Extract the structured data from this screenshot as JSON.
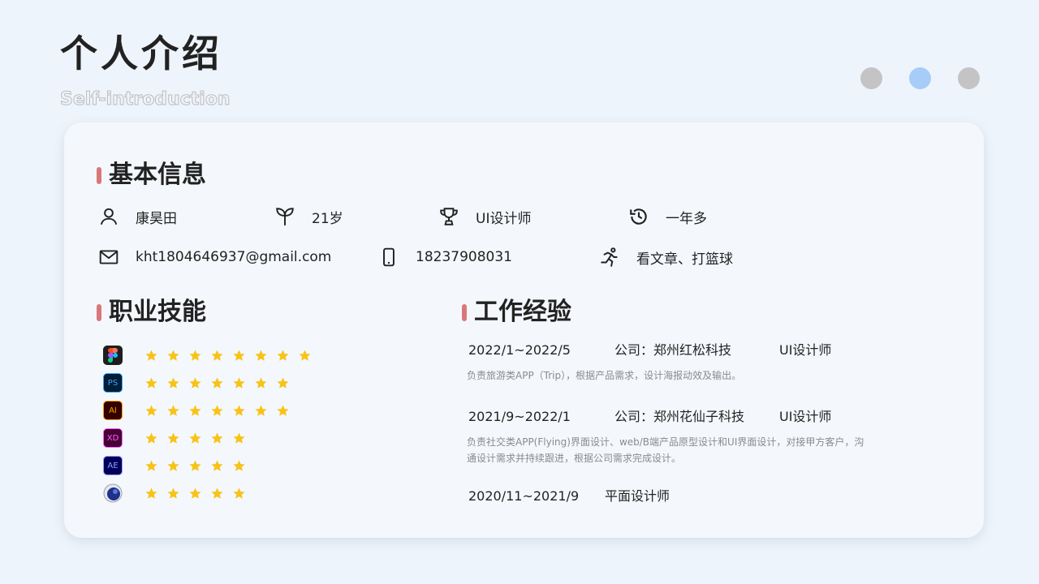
{
  "header": {
    "title": "个人介绍",
    "subtitle": "Self-introduction",
    "page_dots": [
      {
        "active": false
      },
      {
        "active": true
      },
      {
        "active": false
      }
    ]
  },
  "basic_info": {
    "title": "基本信息",
    "name": "康昊田",
    "age": "21岁",
    "role": "UI设计师",
    "experience": "一年多",
    "email": "kht1804646937@gmail.com",
    "phone": "18237908031",
    "hobbies": "看文章、打篮球",
    "icons": [
      "user-icon",
      "sprout-icon",
      "trophy-icon",
      "history-icon",
      "mail-icon",
      "phone-icon",
      "running-icon"
    ]
  },
  "skills": {
    "title": "职业技能",
    "items": [
      {
        "icon": "figma-icon",
        "app_label": "",
        "rating": 8,
        "color": "#1e1e1e"
      },
      {
        "icon": "photoshop-icon",
        "app_label": "PS",
        "rating": 7,
        "color": "#001e36"
      },
      {
        "icon": "illustrator-icon",
        "app_label": "AI",
        "rating": 7,
        "color": "#330000"
      },
      {
        "icon": "xd-icon",
        "app_label": "XD",
        "rating": 5,
        "color": "#470137"
      },
      {
        "icon": "after-effects-icon",
        "app_label": "AE",
        "rating": 5,
        "color": "#00005b"
      },
      {
        "icon": "cinema4d-icon",
        "app_label": "",
        "rating": 5,
        "color": "#1a2a7a"
      }
    ],
    "star_color": "#f8c318"
  },
  "work": {
    "title": "工作经验",
    "jobs": [
      {
        "period": "2022/1~2022/5",
        "company": "公司：郑州红松科技",
        "role": "UI设计师",
        "desc": "负责旅游类APP（Trip），根据产品需求，设计海报动效及输出。"
      },
      {
        "period": "2021/9~2022/1",
        "company": "公司：郑州花仙子科技",
        "role": "UI设计师",
        "desc": "负责社交类APP(Flying)界面设计、web/B端产品原型设计和UI界面设计，对接甲方客户，沟通设计需求并持续跟进，根据公司需求完成设计。"
      },
      {
        "period": "2020/11~2021/9",
        "company": "",
        "role": "平面设计师",
        "desc": ""
      }
    ]
  },
  "colors": {
    "accent_bar": "#d97878",
    "active_dot": "#a6cdf8",
    "inactive_dot": "#c4c4c4"
  }
}
